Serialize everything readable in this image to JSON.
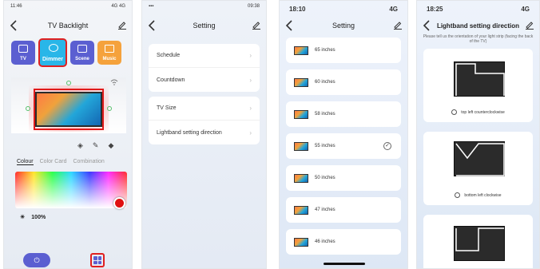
{
  "screen1": {
    "status_time": "11:46",
    "status_right": "4G 4G",
    "title": "TV Backlight",
    "tiles": [
      "TV",
      "Dimmer",
      "Scene",
      "Music"
    ],
    "color_tabs": [
      "Colour",
      "Color Card",
      "Combination"
    ],
    "brightness": "100%",
    "colors": {
      "accent": "#5b5fd1",
      "highlight": "#e02020"
    }
  },
  "screen2": {
    "status_time": "09:38",
    "title": "Setting",
    "group1": [
      "Schedule",
      "Countdown"
    ],
    "group2": [
      "TV Size",
      "Lightband setting direction"
    ]
  },
  "screen3": {
    "status_time": "18:10",
    "status_right": "4G",
    "title": "Setting",
    "sizes": [
      "65 inches",
      "60 inches",
      "58 inches",
      "55 inches",
      "50 inches",
      "47 inches",
      "46 inches"
    ],
    "selected": "55 inches"
  },
  "screen4": {
    "status_time": "18:25",
    "status_right": "4G",
    "title": "Lightband setting direction",
    "hint": "Please tell us the orientation of your light strip (facing the back of the TV)",
    "options": [
      "top left counterclockwise",
      "bottom left clockwise"
    ]
  }
}
